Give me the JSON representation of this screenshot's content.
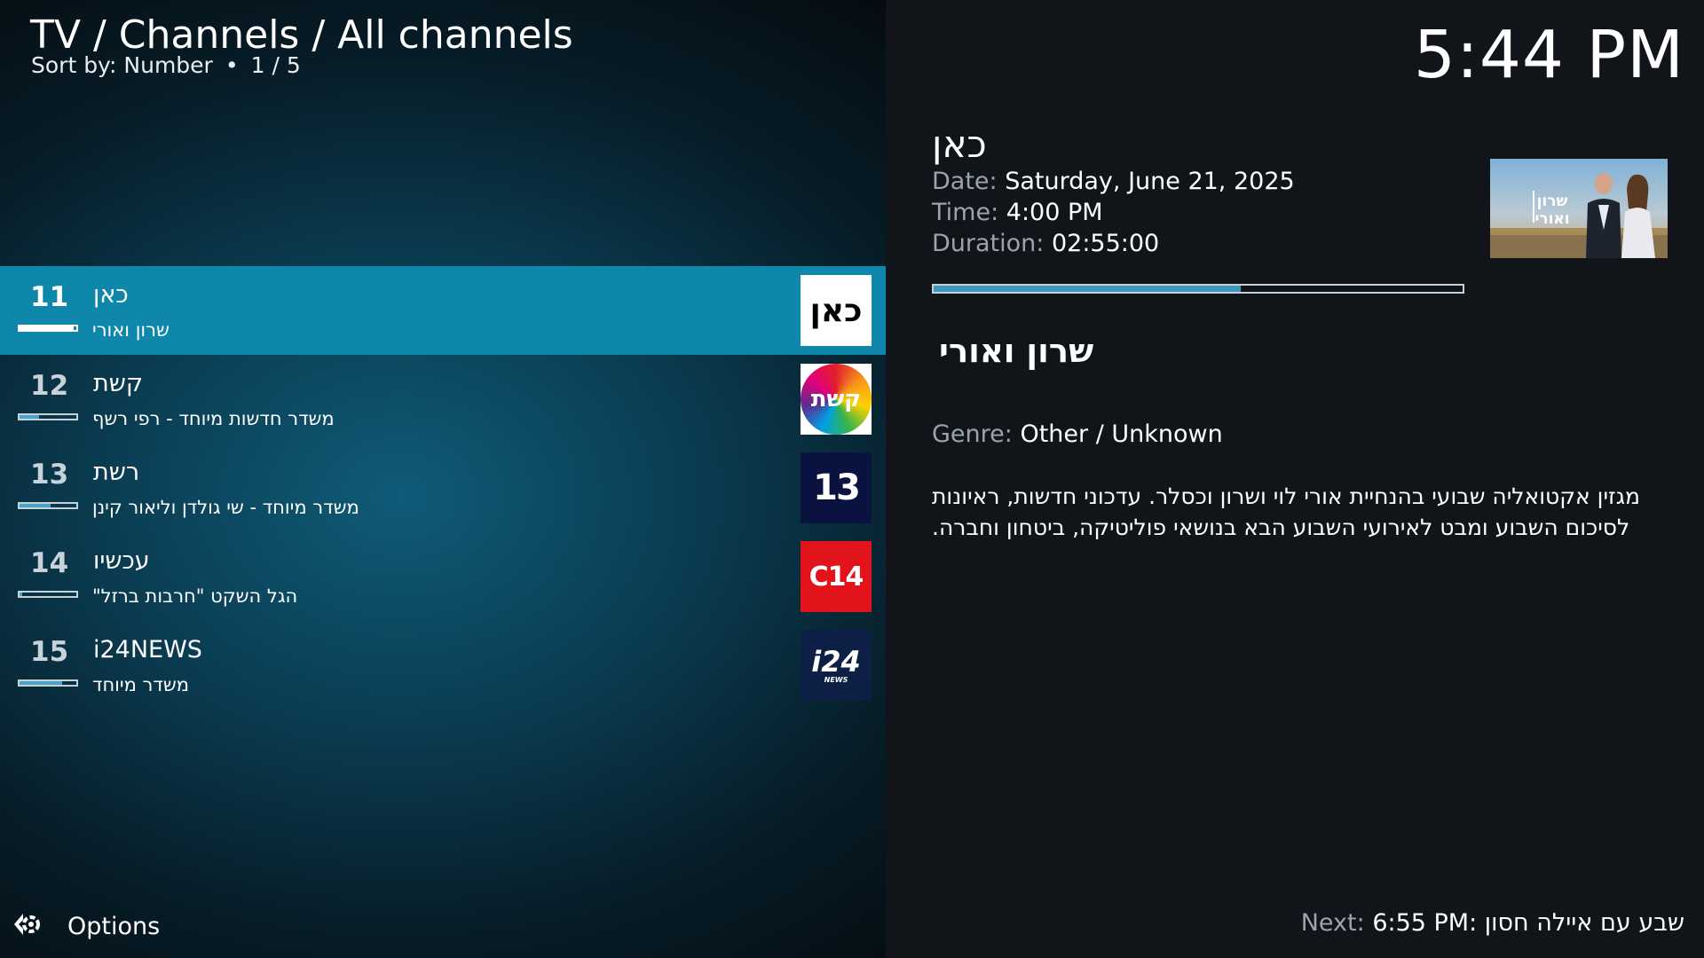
{
  "header": {
    "breadcrumb": "TV / Channels / All channels",
    "sort_label": "Sort by: Number",
    "page_info": "1 / 5",
    "separator": "•"
  },
  "clock": "5:44 PM",
  "channels": [
    {
      "number": "11",
      "name": "כאן",
      "program": "שרון ואורי",
      "progress": 0.95,
      "logo": "kan-logo",
      "logo_text": "כאן",
      "selected": true
    },
    {
      "number": "12",
      "name": "קשת",
      "program": "משדר חדשות מיוחד - רפי רשף",
      "progress": 0.35,
      "logo": "keshet-logo",
      "logo_text": "קשת",
      "selected": false
    },
    {
      "number": "13",
      "name": "רשת",
      "program": "משדר מיוחד  - שי גולדן וליאור קינן",
      "progress": 0.55,
      "logo": "reshet13-logo",
      "logo_text": "13",
      "selected": false
    },
    {
      "number": "14",
      "name": "עכשיו",
      "program": "הגל השקט \"חרבות ברזל\"",
      "progress": 0.05,
      "logo": "c14-logo",
      "logo_text": "C14",
      "selected": false
    },
    {
      "number": "15",
      "name": "i24NEWS",
      "program": "משדר מיוחד",
      "progress": 0.75,
      "logo": "i24-logo",
      "logo_text": "i24",
      "logo_subtext": "NEWS",
      "selected": false
    }
  ],
  "details": {
    "channel_name": "כאן",
    "date_label": "Date:",
    "date_value": "Saturday, June 21, 2025",
    "time_label": "Time:",
    "time_value": "4:00 PM",
    "duration_label": "Duration:",
    "duration_value": "02:55:00",
    "progress": 0.58,
    "program_title": "שרון ואורי",
    "genre_label": "Genre:",
    "genre_value": "Other / Unknown",
    "plot": "מגזין אקטואליה שבועי בהנחיית אורי לוי ושרון וכסלר. עדכוני חדשות, ראיונות לסיכום השבוע ומבט לאירועי השבוע הבא בנושאי פוליטיקה, ביטחון וחברה.",
    "thumbnail_text": "שרון ואורי"
  },
  "next": {
    "label": "Next:",
    "value": "6:55 PM: שבע עם איילה חסון"
  },
  "options": {
    "label": "Options",
    "icon": "options-arrow-icon"
  },
  "colors": {
    "selected_row": "#0f87aa",
    "kan_bg": "#ffffff",
    "reshet_bg": "#0a1240",
    "c14_bg": "#e3131b",
    "i24_bg": "#0e1f45"
  }
}
